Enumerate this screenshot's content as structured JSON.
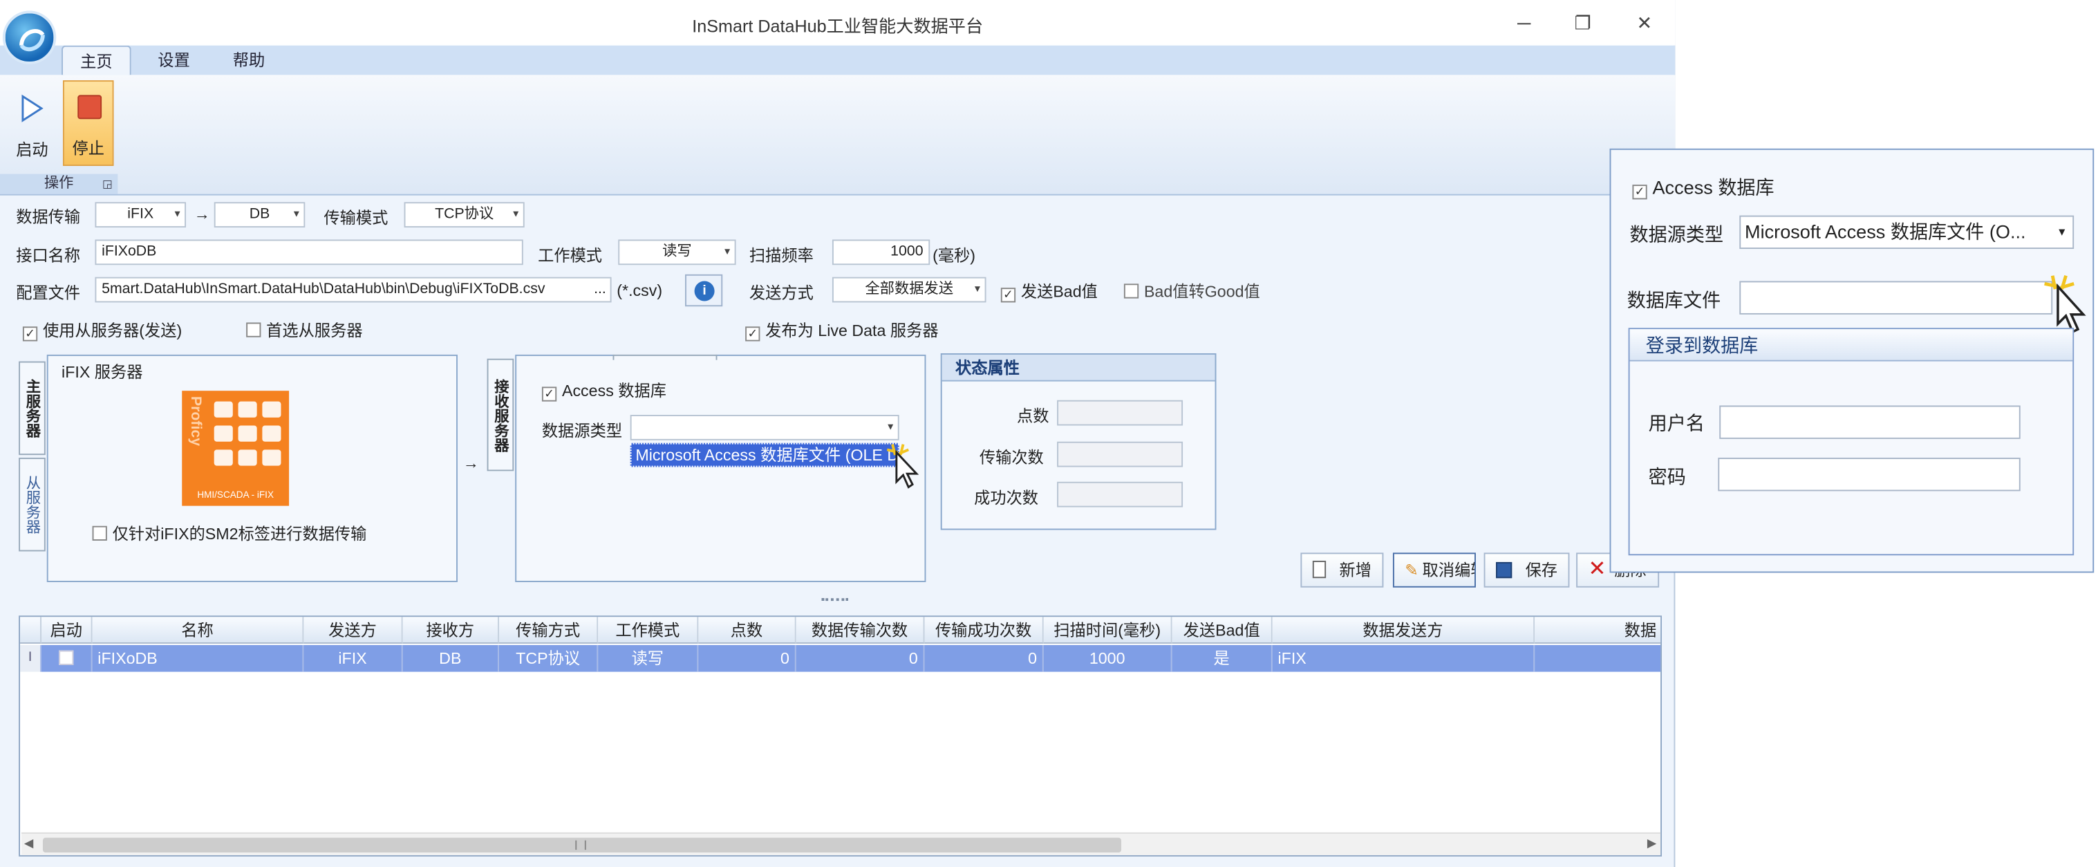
{
  "window": {
    "title": "InSmart DataHub工业智能大数据平台",
    "minimize": "─",
    "restore": "❐",
    "close": "✕"
  },
  "ribbon": {
    "tabs": [
      "主页",
      "设置",
      "帮助"
    ],
    "start_label": "启动",
    "stop_label": "停止",
    "group_label": "操作"
  },
  "form": {
    "transfer_label": "数据传输",
    "source": "iFIX",
    "arrow": "→",
    "target": "DB",
    "transfer_mode_label": "传输模式",
    "transfer_mode": "TCP协议",
    "interface_label": "接口名称",
    "interface_value": "iFIXoDB",
    "work_mode_label": "工作模式",
    "work_mode": "读写",
    "scan_label": "扫描频率",
    "scan_value": "1000",
    "scan_unit": "(毫秒)",
    "config_label": "配置文件",
    "config_value": "5mart.DataHub\\InSmart.DataHub\\DataHub\\bin\\Debug\\iFIXToDB.csv",
    "browse": "...",
    "config_ext": "(*.csv)",
    "send_mode_label": "发送方式",
    "send_mode": "全部数据发送",
    "send_bad_label": "发送Bad值",
    "bad_to_good_label": "Bad值转Good值",
    "use_slave_label": "使用从服务器(发送)",
    "prefer_slave_label": "首选从服务器",
    "publish_label": "发布为 Live Data 服务器"
  },
  "left_panel": {
    "tab_main": "主服务器",
    "tab_slave": "从服务器",
    "title": "iFIX 服务器",
    "logo_text": "Proficy",
    "logo_caption": "HMI/SCADA - iFIX",
    "sm2_label": "仅针对iFIX的SM2标签进行数据传输"
  },
  "middle_panel": {
    "tab_label": "接收服务器",
    "access_label": "Access 数据库",
    "ds_type_label": "数据源类型",
    "dropdown_item": "Microsoft Access 数据库文件 (OLE DB)"
  },
  "status_panel": {
    "title": "状态属性",
    "points_label": "点数",
    "transfers_label": "传输次数",
    "success_label": "成功次数"
  },
  "actions": {
    "add": "新增",
    "cancel_edit": "取消编辑",
    "save": "保存",
    "delete": "删除"
  },
  "grid": {
    "columns": [
      "启动",
      "名称",
      "发送方",
      "接收方",
      "传输方式",
      "工作模式",
      "点数",
      "数据传输次数",
      "传输成功次数",
      "扫描时间(毫秒)",
      "发送Bad值",
      "数据发送方",
      "数据"
    ],
    "row": {
      "name": "iFIXoDB",
      "sender": "iFIX",
      "receiver": "DB",
      "method": "TCP协议",
      "mode": "读写",
      "points": "0",
      "transfers": "0",
      "success": "0",
      "scan": "1000",
      "send_bad": "是",
      "data_sender": "iFIX"
    }
  },
  "callout": {
    "access_label": "Access 数据库",
    "ds_type_label": "数据源类型",
    "ds_type_value": "Microsoft Access 数据库文件 (O...",
    "db_file_label": "数据库文件",
    "login_title": "登录到数据库",
    "username_label": "用户名",
    "password_label": "密码"
  },
  "colors": {
    "accent": "#7f9ee6",
    "ribbon": "#cfe0f5",
    "stop": "#e0533a",
    "logo": "#f58220"
  }
}
